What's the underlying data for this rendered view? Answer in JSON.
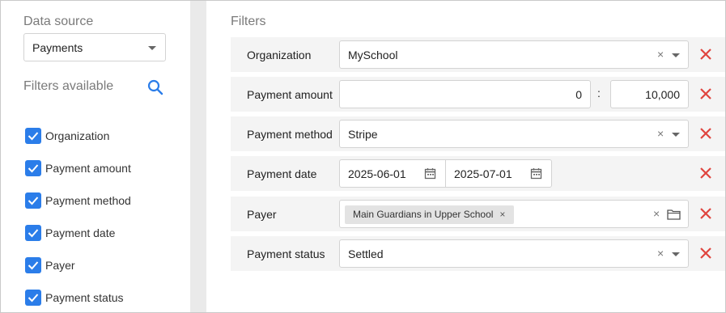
{
  "sidebar": {
    "data_source_label": "Data source",
    "data_source_value": "Payments",
    "filters_available_label": "Filters available",
    "search_icon": "search-icon",
    "checkbox_color": "#2b7de9",
    "items": [
      {
        "label": "Organization",
        "checked": true
      },
      {
        "label": "Payment amount",
        "checked": true
      },
      {
        "label": "Payment method",
        "checked": true
      },
      {
        "label": "Payment date",
        "checked": true
      },
      {
        "label": "Payer",
        "checked": true
      },
      {
        "label": "Payment status",
        "checked": true
      }
    ]
  },
  "filters": {
    "title": "Filters",
    "delete_icon": "close-icon",
    "delete_color": "#e0443e",
    "organization": {
      "label": "Organization",
      "value": "MySchool",
      "clear": "×"
    },
    "payment_amount": {
      "label": "Payment amount",
      "min": "0",
      "separator": ":",
      "max": "10,000"
    },
    "payment_method": {
      "label": "Payment method",
      "value": "Stripe",
      "clear": "×"
    },
    "payment_date": {
      "label": "Payment date",
      "from": "2025-06-01",
      "to": "2025-07-01"
    },
    "payer": {
      "label": "Payer",
      "tag": "Main Guardians in Upper School",
      "tag_remove": "×",
      "clear": "×"
    },
    "payment_status": {
      "label": "Payment status",
      "value": "Settled",
      "clear": "×"
    }
  }
}
